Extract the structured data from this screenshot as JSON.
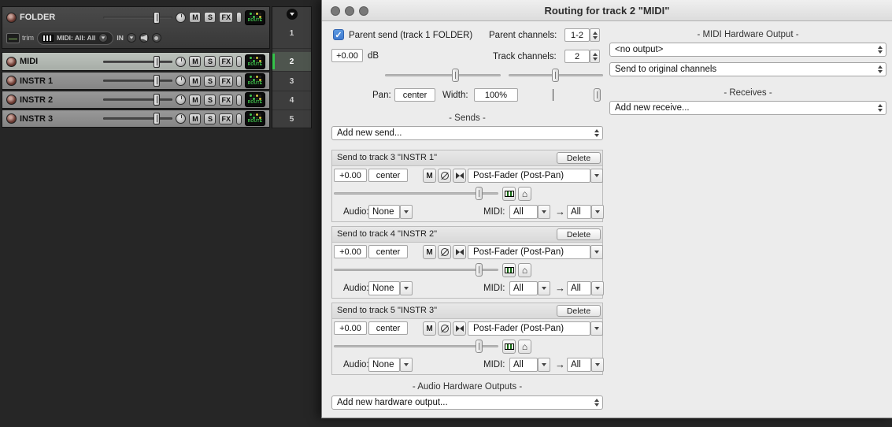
{
  "window": {
    "title": "Routing for track 2 \"MIDI\""
  },
  "icons": {
    "check": "✓",
    "arrow_right": "→",
    "home": "⌂"
  },
  "tracks": {
    "buttons": {
      "mute": "M",
      "solo": "S",
      "fx": "FX",
      "route": "ROUTE"
    },
    "folder": {
      "name": "FOLDER",
      "number": "1",
      "trim": "trim",
      "midi_input": "MIDI: All: All",
      "input": "IN"
    },
    "list": [
      {
        "name": "MIDI",
        "number": "2"
      },
      {
        "name": "INSTR 1",
        "number": "3"
      },
      {
        "name": "INSTR 2",
        "number": "4"
      },
      {
        "name": "INSTR 3",
        "number": "5"
      }
    ]
  },
  "routing": {
    "parent_send_label": "Parent send (track 1 FOLDER)",
    "parent_channels_label": "Parent channels:",
    "parent_channels_value": "1-2",
    "track_channels_label": "Track channels:",
    "track_channels_value": "2",
    "volume_value": "+0.00",
    "db_label": "dB",
    "pan_label": "Pan:",
    "pan_value": "center",
    "width_label": "Width:",
    "width_value": "100%",
    "sends_header": "- Sends -",
    "add_send": "Add new send...",
    "midi_hw_header": "- MIDI Hardware Output -",
    "midi_output_value": "<no output>",
    "midi_output_mode": "Send to original channels",
    "receives_header": "- Receives -",
    "add_receive": "Add new receive...",
    "audio_hw_header": "- Audio Hardware Outputs -",
    "add_hw_output": "Add new hardware output...",
    "send_common": {
      "delete_label": "Delete",
      "mute_label": "M",
      "audio_label": "Audio:",
      "midi_label": "MIDI:"
    },
    "sends": [
      {
        "title": "Send to track 3 \"INSTR 1\"",
        "volume": "+0.00",
        "pan": "center",
        "mode": "Post-Fader (Post-Pan)",
        "audio_dest": "None",
        "midi_src": "All",
        "midi_dest": "All"
      },
      {
        "title": "Send to track 4 \"INSTR 2\"",
        "volume": "+0.00",
        "pan": "center",
        "mode": "Post-Fader (Post-Pan)",
        "audio_dest": "None",
        "midi_src": "All",
        "midi_dest": "All"
      },
      {
        "title": "Send to track 5 \"INSTR 3\"",
        "volume": "+0.00",
        "pan": "center",
        "mode": "Post-Fader (Post-Pan)",
        "audio_dest": "None",
        "midi_src": "All",
        "midi_dest": "All"
      }
    ]
  }
}
